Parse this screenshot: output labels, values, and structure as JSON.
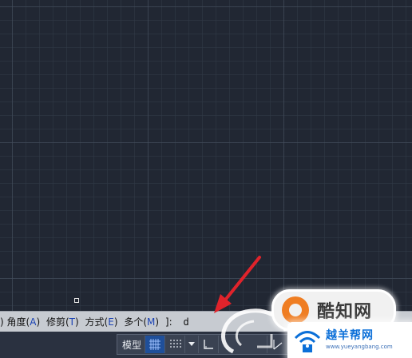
{
  "command_line": {
    "options": [
      {
        "label": "角度",
        "key": "A"
      },
      {
        "label": "修剪",
        "key": "T"
      },
      {
        "label": "方式",
        "key": "E"
      },
      {
        "label": "多个",
        "key": "M"
      }
    ],
    "leading_fragment": ")",
    "suffix": "]:",
    "input_value": "d"
  },
  "status_bar": {
    "model_label": "模型"
  },
  "watermarks": {
    "kuzhi": "酷知网",
    "yueyang_title": "越羊帮网",
    "yueyang_url": "www.yueyangbang.com"
  },
  "colors": {
    "canvas": "#212733",
    "arrow": "#e0232b",
    "command_bar": "#c7cbd1",
    "option_key": "#1b43b5"
  }
}
